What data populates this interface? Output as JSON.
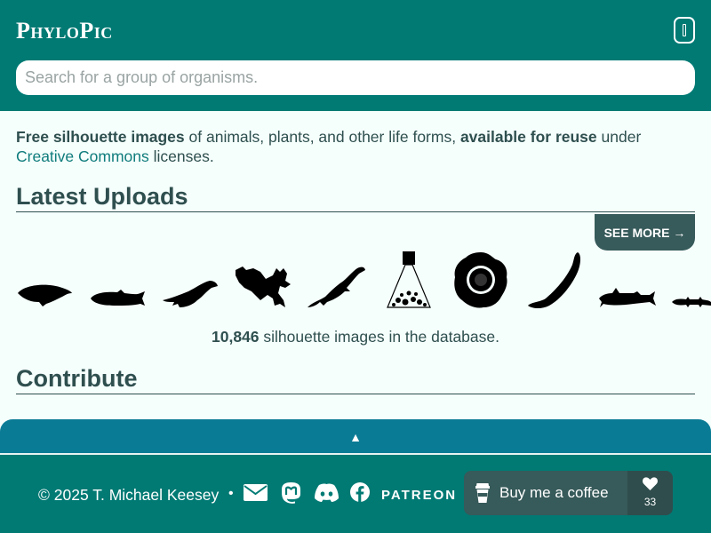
{
  "header": {
    "logo": "PhyloPic",
    "menu_icon": "menu-icon",
    "search_placeholder": "Search for a group of organisms."
  },
  "intro": {
    "part1": "Free silhouette images",
    "part2": " of animals, plants, and other life forms, ",
    "part3": "available for reuse",
    "part4": " under ",
    "link": "Creative Commons",
    "part5": " licenses."
  },
  "latest": {
    "title": "Latest Uploads",
    "see_more": "SEE MORE →",
    "silhouettes": [
      "whale-silhouette",
      "fish-silhouette",
      "marine-reptile-silhouette",
      "lizard-silhouette",
      "plesiosaur-silhouette",
      "flask-icon",
      "rafflesia-flower-silhouette",
      "worm-silhouette",
      "catfish-silhouette",
      "small-reptile-silhouette"
    ],
    "count_value": "10,846",
    "count_text": " silhouette images in the database."
  },
  "contribute": {
    "title": "Contribute"
  },
  "drawer": {
    "toggle": "▲"
  },
  "footer": {
    "copyright": "© 2025 T. Michael Keesey",
    "separator": "•",
    "social_icons": [
      "email-icon",
      "mastodon-icon",
      "discord-icon",
      "facebook-icon"
    ],
    "patreon": "PATREON",
    "coffee_label": "Buy me a coffee",
    "coffee_likes": "33"
  },
  "colors": {
    "header_bg": "#017a74",
    "page_bg": "#f5fffc",
    "text": "#2f4f4f",
    "link": "#0f7c7c",
    "drawer_bg": "#0a7b95",
    "button_bg": "#375a5a"
  }
}
